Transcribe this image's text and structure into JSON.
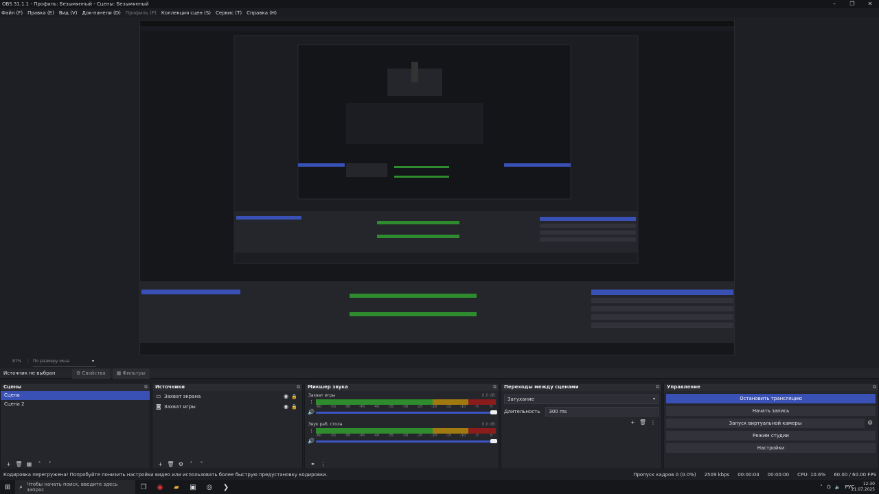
{
  "window": {
    "title": "OBS 31.1.1 - Профиль: Безымянный - Сцены: Безымянный"
  },
  "menu": [
    "Файл (F)",
    "Правка (E)",
    "Вид (V)",
    "Док-панели (D)",
    "Профиль (P)",
    "Коллекция сцен (S)",
    "Сервис (T)",
    "Справка (H)"
  ],
  "menu_disabled_index": 4,
  "zoom": {
    "percent": "87%",
    "fit_label": "По размеру окна"
  },
  "context_bar": {
    "no_source": "Источник не выбран",
    "properties": "Свойства",
    "filters": "Фильтры"
  },
  "scenes": {
    "title": "Сцены",
    "items": [
      "Сцена",
      "Сцена 2"
    ],
    "selected": 0
  },
  "sources": {
    "title": "Источники",
    "items": [
      {
        "name": "Захват экрана",
        "icon": "monitor-icon"
      },
      {
        "name": "Захват игры",
        "icon": "gamepad-icon"
      }
    ]
  },
  "mixer": {
    "title": "Микшер звука",
    "channels": [
      {
        "name": "Захват игры",
        "db": "0.0 dB"
      },
      {
        "name": "Звук раб. стола",
        "db": "0.0 dB"
      }
    ],
    "ticks": [
      "-60",
      "-55",
      "-50",
      "-45",
      "-40",
      "-35",
      "-30",
      "-25",
      "-20",
      "-15",
      "-10",
      "-5",
      "0"
    ]
  },
  "transitions": {
    "title": "Переходы между сценами",
    "type": "Затухание",
    "duration_label": "Длительность",
    "duration_value": "300 ms"
  },
  "controls": {
    "title": "Управление",
    "stop_stream": "Остановить трансляцию",
    "start_record": "Начать запись",
    "virtual_cam": "Запуск виртуальной камеры",
    "studio_mode": "Режим студии",
    "settings": "Настройки"
  },
  "status": {
    "message": "Кодировка перегружена! Попробуйте понизить настройки видео или использовать более быструю предустановку кодировки.",
    "dropped": "Пропуск кадров 0 (0.0%)",
    "bitrate": "2509 kbps",
    "stream_time": "00:00:04",
    "record_time": "00:00:00",
    "cpu": "CPU: 10.6%",
    "fps": "60.00 / 60.00 FPS"
  },
  "taskbar": {
    "search_placeholder": "Чтобы начать поиск, введите здесь запрос",
    "lang": "РУС",
    "time": "12:30",
    "date": "21.07.2025"
  },
  "colors": {
    "accent": "#3950b5",
    "meter_green": "#2e8b2e",
    "meter_yellow": "#a07a10",
    "meter_red": "#8a1c1c"
  }
}
